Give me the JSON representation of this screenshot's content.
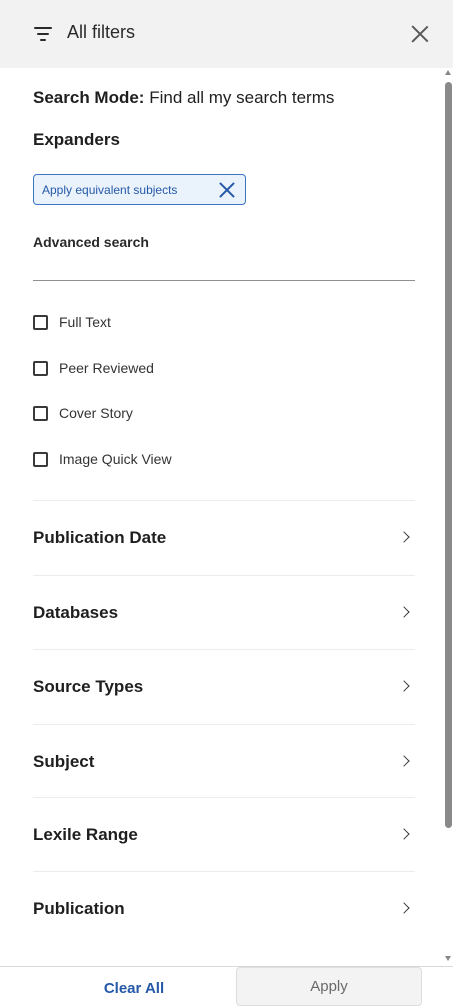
{
  "header": {
    "title": "All filters",
    "filter_icon": "filter-icon",
    "close_icon": "close-icon"
  },
  "search_mode": {
    "label": "Search Mode:",
    "value": "Find all my search terms"
  },
  "expanders": {
    "heading": "Expanders",
    "chips": [
      {
        "label": "Apply equivalent subjects",
        "remove_icon": "close-icon"
      }
    ]
  },
  "advanced_search": {
    "heading": "Advanced search",
    "options": [
      {
        "label": "Full Text",
        "checked": false
      },
      {
        "label": "Peer Reviewed",
        "checked": false
      },
      {
        "label": "Cover Story",
        "checked": false
      },
      {
        "label": "Image Quick View",
        "checked": false
      }
    ]
  },
  "facets": [
    {
      "label": "Publication Date",
      "icon": "chevron-right-icon"
    },
    {
      "label": "Databases",
      "icon": "chevron-right-icon"
    },
    {
      "label": "Source Types",
      "icon": "chevron-right-icon"
    },
    {
      "label": "Subject",
      "icon": "chevron-right-icon"
    },
    {
      "label": "Lexile Range",
      "icon": "chevron-right-icon"
    },
    {
      "label": "Publication",
      "icon": "chevron-right-icon"
    }
  ],
  "footer": {
    "clear_label": "Clear All",
    "apply_label": "Apply"
  },
  "colors": {
    "accent": "#2559a8",
    "chip_background": "#eaf2fb",
    "header_background": "#f2f2f2"
  }
}
